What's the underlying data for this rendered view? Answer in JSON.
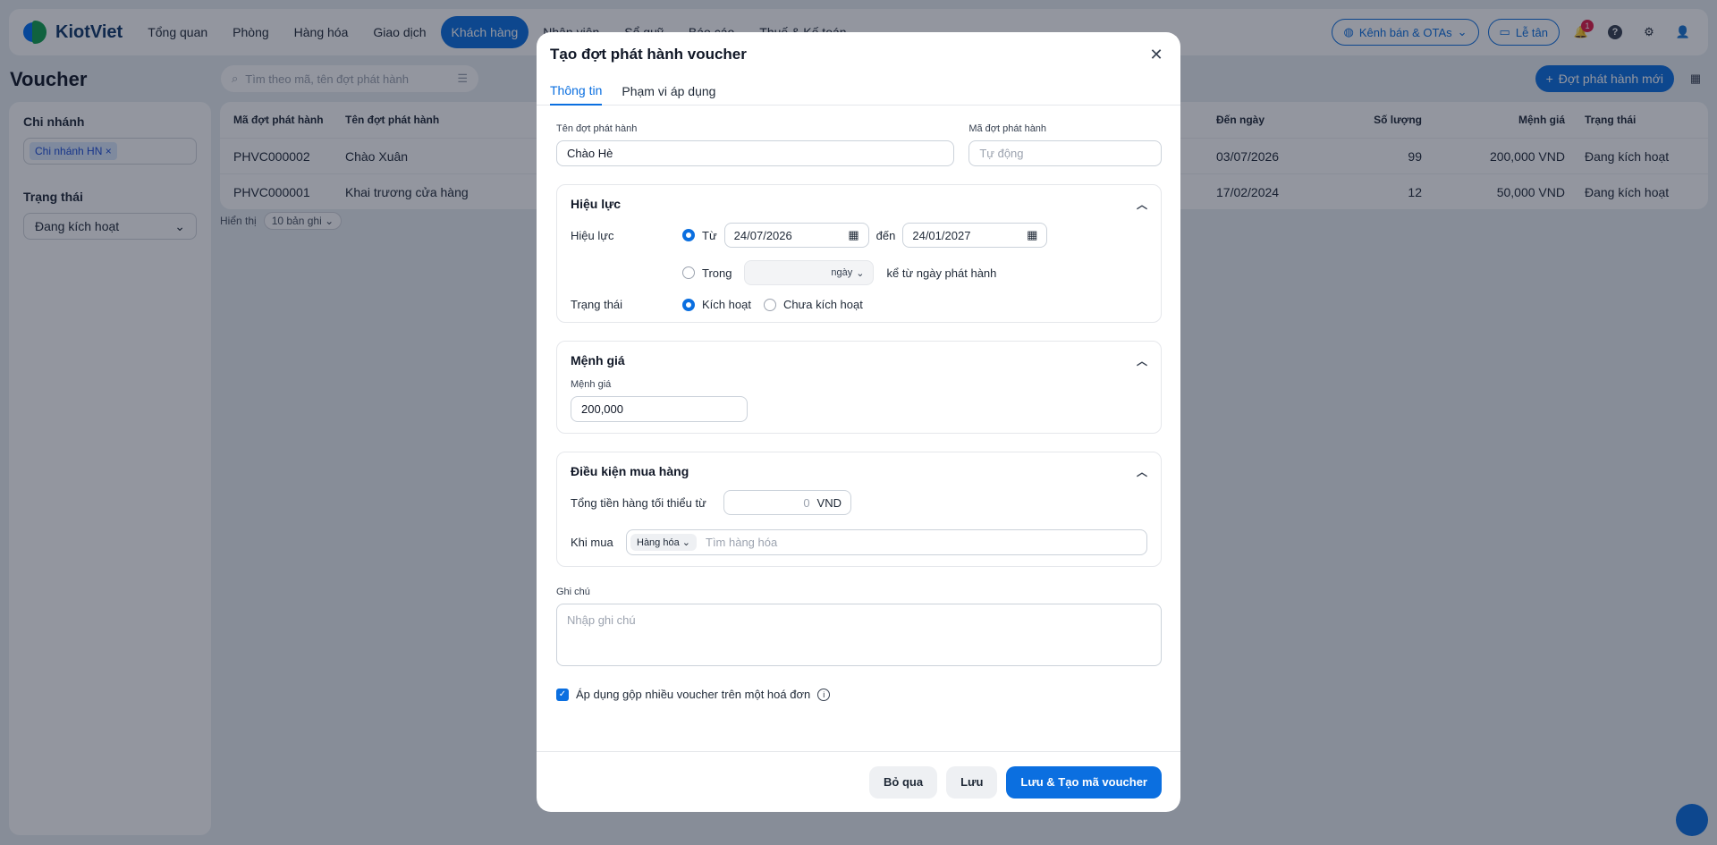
{
  "app": {
    "brand": "KiotViet",
    "nav": [
      "Tổng quan",
      "Phòng",
      "Hàng hóa",
      "Giao dịch",
      "Khách hàng",
      "Nhân viên",
      "Sổ quỹ",
      "Báo cáo",
      "Thuế & Kế toán"
    ],
    "nav_active_index": 4,
    "channels_label": "Kênh bán & OTAs",
    "frontdesk_label": "Lễ tân",
    "notification_count": "1",
    "help_glyph": "?"
  },
  "page": {
    "title": "Voucher",
    "search_placeholder": "Tìm theo mã, tên đợt phát hành",
    "new_button": "Đợt phát hành mới",
    "filters": {
      "branch_label": "Chi nhánh",
      "branch_tag": "Chi nhánh HN",
      "status_label": "Trạng thái",
      "status_value": "Đang kích hoạt"
    },
    "table": {
      "columns": [
        "Mã đợt phát hành",
        "Tên đợt phát hành",
        "Đến ngày",
        "Số lượng",
        "Mệnh giá",
        "Trạng thái"
      ],
      "rows": [
        [
          "PHVC000002",
          "Chào Xuân",
          "03/07/2026",
          "99",
          "200,000 VND",
          "Đang kích hoạt"
        ],
        [
          "PHVC000001",
          "Khai trương cửa hàng",
          "17/02/2024",
          "12",
          "50,000 VND",
          "Đang kích hoạt"
        ]
      ]
    },
    "page_size_label": "Hiển thị",
    "page_size_value": "10 bản ghi"
  },
  "modal": {
    "title": "Tạo đợt phát hành voucher",
    "tabs": [
      "Thông tin",
      "Phạm vi áp dụng"
    ],
    "name_label": "Tên đợt phát hành",
    "name_value": "Chào Hè",
    "code_label": "Mã đợt phát hành",
    "code_placeholder": "Tự động",
    "validity": {
      "title": "Hiệu lực",
      "row_label": "Hiệu lực",
      "from_label": "Từ",
      "from_date": "24/07/2026",
      "to_label": "đến",
      "to_date": "24/01/2027",
      "within_label": "Trong",
      "unit": "ngày",
      "suffix": "kể từ ngày phát hành",
      "status_label": "Trạng thái",
      "active": "Kích hoạt",
      "inactive": "Chưa kích hoạt"
    },
    "denomination": {
      "title": "Mệnh giá",
      "label": "Mệnh giá",
      "value": "200,000"
    },
    "conditions": {
      "title": "Điều kiện mua hàng",
      "min_total_label": "Tổng tiền hàng tối thiểu từ",
      "min_total_value": "0",
      "currency": "VND",
      "buy_label": "Khi mua",
      "buy_type": "Hàng hóa",
      "buy_placeholder": "Tìm hàng hóa"
    },
    "note_label": "Ghi chú",
    "note_placeholder": "Nhập ghi chú",
    "stack_label": "Áp dụng gộp nhiều voucher trên một hoá đơn",
    "buttons": {
      "skip": "Bỏ qua",
      "save": "Lưu",
      "save_generate": "Lưu & Tạo mã voucher"
    }
  }
}
